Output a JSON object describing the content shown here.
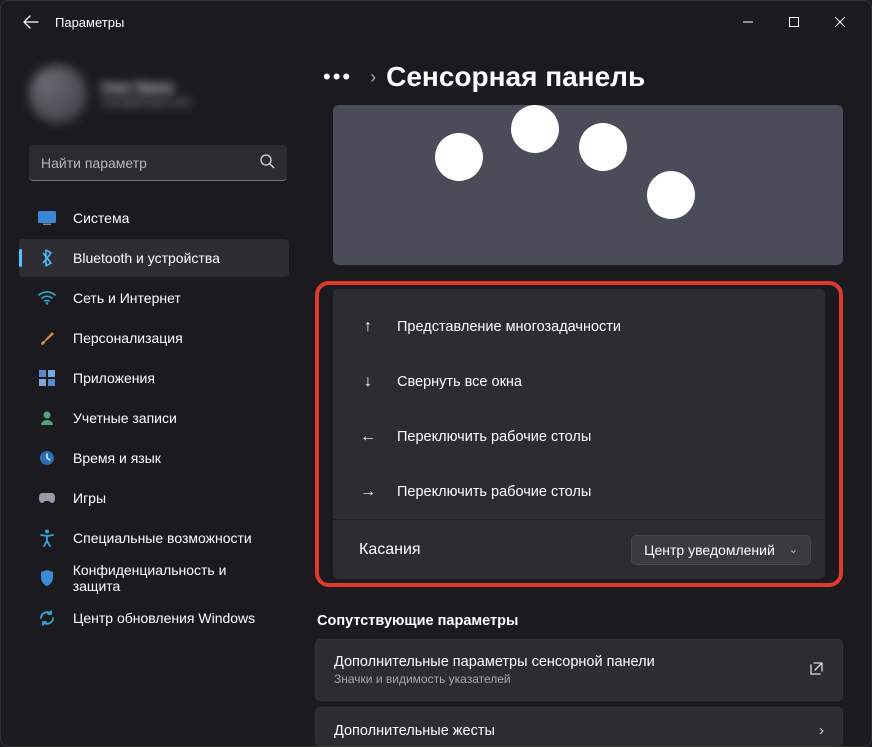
{
  "window": {
    "title": "Параметры"
  },
  "profile": {
    "name": "User Name",
    "email": "user@email.com"
  },
  "search": {
    "placeholder": "Найти параметр"
  },
  "nav": {
    "system": "Система",
    "bluetooth": "Bluetooth и устройства",
    "network": "Сеть и Интернет",
    "personalization": "Персонализация",
    "apps": "Приложения",
    "accounts": "Учетные записи",
    "time": "Время и язык",
    "gaming": "Игры",
    "accessibility": "Специальные возможности",
    "privacy": "Конфиденциальность и защита",
    "update": "Центр обновления Windows"
  },
  "page": {
    "breadcrumb_title": "Сенсорная панель"
  },
  "gestures": {
    "up": "Представление многозадачности",
    "down": "Свернуть все окна",
    "left": "Переключить рабочие столы",
    "right": "Переключить рабочие столы",
    "tap_label": "Касания",
    "tap_value": "Центр уведомлений"
  },
  "related": {
    "heading": "Сопутствующие параметры",
    "touchpad_more": {
      "title": "Дополнительные параметры сенсорной панели",
      "subtitle": "Значки и видимость указателей"
    },
    "gestures_more": {
      "title": "Дополнительные жесты"
    }
  }
}
